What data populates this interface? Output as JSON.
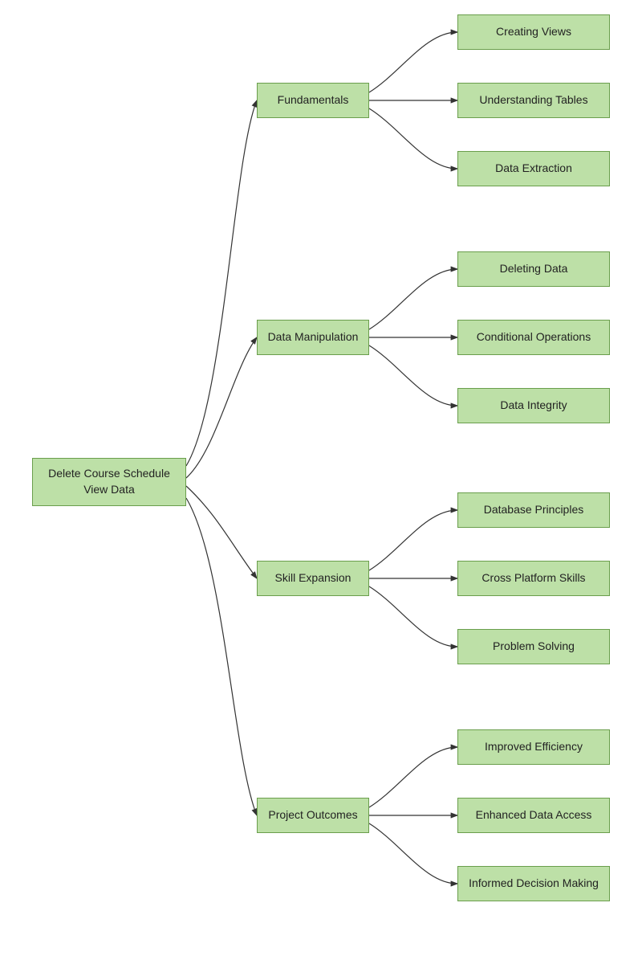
{
  "root": {
    "label": "Delete Course Schedule\nView Data"
  },
  "branches": [
    {
      "label": "Fundamentals",
      "leaves": [
        {
          "label": "Creating Views"
        },
        {
          "label": "Understanding Tables"
        },
        {
          "label": "Data Extraction"
        }
      ]
    },
    {
      "label": "Data Manipulation",
      "leaves": [
        {
          "label": "Deleting Data"
        },
        {
          "label": "Conditional Operations"
        },
        {
          "label": "Data Integrity"
        }
      ]
    },
    {
      "label": "Skill Expansion",
      "leaves": [
        {
          "label": "Database Principles"
        },
        {
          "label": "Cross Platform Skills"
        },
        {
          "label": "Problem Solving"
        }
      ]
    },
    {
      "label": "Project Outcomes",
      "leaves": [
        {
          "label": "Improved Efficiency"
        },
        {
          "label": "Enhanced Data Access"
        },
        {
          "label": "Informed Decision Making"
        }
      ]
    }
  ],
  "colors": {
    "fill": "#bde0a7",
    "stroke": "#6a9e4c",
    "arrow": "#333333"
  }
}
